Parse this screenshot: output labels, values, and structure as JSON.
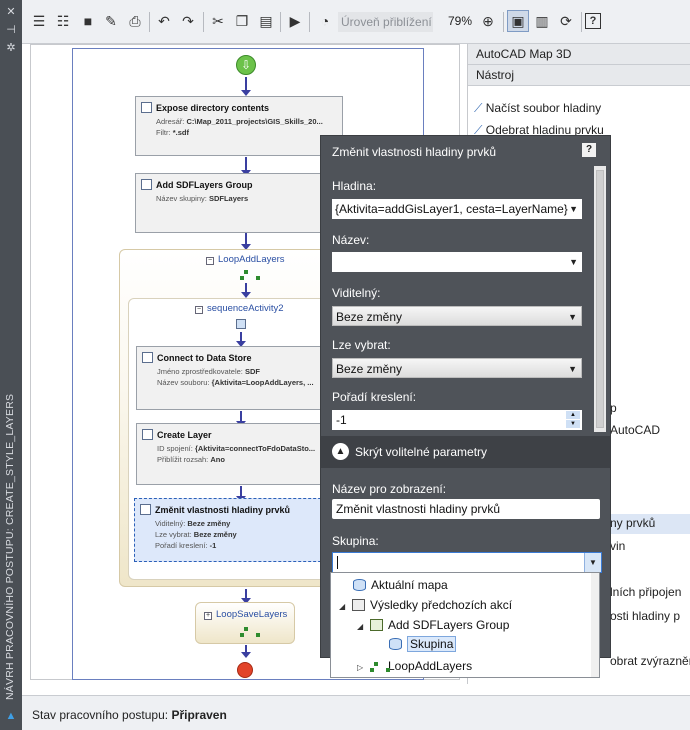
{
  "left_strip": {
    "title": "NÁVRH PRACOVNÍHO POSTUPU: CREATE_STYLE_LAYERS"
  },
  "toolbar": {
    "zoom_field": "Úroveň přiblížení",
    "zoom_percent": "79%"
  },
  "workflow": {
    "activities": {
      "expose": {
        "title": "Expose directory contents",
        "rows": [
          {
            "label": "Adresář:",
            "value": "C:\\Map_2011_projects\\GIS_Skills_20..."
          },
          {
            "label": "Filtr:",
            "value": "*.sdf"
          }
        ]
      },
      "add_group": {
        "title": "Add SDFLayers Group",
        "rows": [
          {
            "label": "Název skupiny:",
            "value": "SDFLayers"
          }
        ]
      },
      "connect": {
        "title": "Connect to Data Store",
        "rows": [
          {
            "label": "Jméno zprostředkovatele:",
            "value": "SDF"
          },
          {
            "label": "Název souboru:",
            "value": "{Aktivita=LoopAddLayers, ..."
          }
        ]
      },
      "create_layer": {
        "title": "Create Layer",
        "rows": [
          {
            "label": "ID spojení:",
            "value": "{Aktivita=connectToFdoDataSto..."
          },
          {
            "label": "Přiblížit rozsah:",
            "value": "Ano"
          }
        ]
      },
      "change_props": {
        "title": "Změnit vlastnosti hladiny prvků",
        "rows": [
          {
            "label": "Viditelný:",
            "value": "Beze změny"
          },
          {
            "label": "Lze vybrat:",
            "value": "Beze změny"
          },
          {
            "label": "Pořadí kreslení:",
            "value": "-1"
          }
        ]
      }
    },
    "loop_add_layers": "LoopAddLayers",
    "sequence_activity": "sequenceActivity2",
    "loop_save_layers": "LoopSaveLayers"
  },
  "status": {
    "label": "Stav pracovního postupu:",
    "value": "Připraven"
  },
  "right_panel": {
    "header1": "AutoCAD Map 3D",
    "header2": "Nástroj",
    "items": [
      "Načíst soubor hladiny",
      "Odebrat hladinu prvku",
      "p",
      "AutoCAD",
      "ny prvků",
      "vin",
      "lních připojen",
      "osti hladiny p",
      "obrat zvýraznění"
    ]
  },
  "dialog": {
    "title": "Změnit vlastnosti hladiny prvků",
    "help": "?",
    "fields": {
      "hladina_label": "Hladina:",
      "hladina_value": "{Aktivita=addGisLayer1, cesta=LayerName}",
      "nazev_label": "Název:",
      "nazev_value": "",
      "viditelny_label": "Viditelný:",
      "viditelny_value": "Beze změny",
      "lze_vybrat_label": "Lze vybrat:",
      "lze_vybrat_value": "Beze změny",
      "poradi_label": "Pořadí kreslení:",
      "poradi_value": "-1"
    },
    "collapse_label": "Skrýt volitelné parametry",
    "optional": {
      "nazev_zobrazeni_label": "Název pro zobrazení:",
      "nazev_zobrazeni_value": "Změnit vlastnosti hladiny prvků",
      "skupina_label": "Skupina:",
      "skupina_value": ""
    }
  },
  "dropdown_tree": {
    "items": [
      "Aktuální mapa",
      "Výsledky předchozích akcí",
      "Add SDFLayers Group",
      "Skupina",
      "LoopAddLayers"
    ]
  }
}
